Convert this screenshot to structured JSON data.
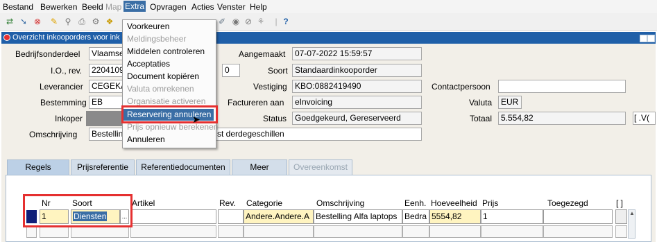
{
  "menubar": {
    "items": [
      "Bestand",
      "Bewerken",
      "Beeld",
      "Map",
      "Extra",
      "Opvragen",
      "Acties",
      "Venster",
      "Help"
    ]
  },
  "toolbar": {
    "help_glyph": "?"
  },
  "window": {
    "title": "Overzicht inkooporders voor ink"
  },
  "form": {
    "labels": {
      "bedrijfsonderdeel": "Bedrijfsonderdeel",
      "io_rev": "I.O., rev.",
      "leverancier": "Leverancier",
      "bestemming": "Bestemming",
      "inkoper": "Inkoper",
      "omschrijving": "Omschrijving",
      "aangemaakt": "Aangemaakt",
      "soort": "Soort",
      "vestiging": "Vestiging",
      "factureren_aan": "Factureren aan",
      "status": "Status",
      "contactpersoon": "Contactpersoon",
      "valuta": "Valuta",
      "totaal": "Totaal"
    },
    "values": {
      "bedrijfsonderdeel": "Vlaamse",
      "io": "2204109",
      "rev": "0",
      "leverancier": "CEGEKA",
      "bestemming": "EB",
      "omschrijving_left": "Bestellin",
      "omschrijving_right": "st derdegeschillen",
      "aangemaakt": "07-07-2022 15:59:57",
      "soort": "Standaardinkooporder",
      "vestiging": "KBO:0882419490",
      "factureren_aan": "eInvoicing",
      "status": "Goedgekeurd, Gereserveerd",
      "contactpersoon": "",
      "valuta": "EUR",
      "totaal": "5.554,82",
      "extra_field": "[ .V("
    }
  },
  "tabs": [
    "Regels",
    "Prijsreferentie",
    "Referentiedocumenten",
    "Meer",
    "Overeenkomst"
  ],
  "lines": {
    "headers": [
      "Nr",
      "Soort",
      "Artikel",
      "Rev.",
      "Categorie",
      "Omschrijving",
      "Eenh.",
      "Hoeveelheid",
      "Prijs",
      "Toegezegd",
      "[ ]"
    ],
    "row": {
      "nr": "1",
      "soort": "Diensten",
      "soort_lov": "...",
      "artikel": "",
      "rev": "",
      "categorie": "Andere.Andere.A",
      "omschrijving": "Bestelling Alfa laptops",
      "eenh": "Bedra",
      "hoeveelheid": "5554,82",
      "prijs": "1",
      "toegezegd": ""
    }
  },
  "extra_menu": {
    "items": [
      {
        "label": "Voorkeuren",
        "enabled": true
      },
      {
        "label": "Meldingsbeheer",
        "enabled": false
      },
      {
        "label": "Middelen controleren",
        "enabled": true
      },
      {
        "label": "Acceptaties",
        "enabled": true
      },
      {
        "label": "Document kopiëren",
        "enabled": true
      },
      {
        "label": "Valuta omrekenen",
        "enabled": false
      },
      {
        "label": "Organisatie activeren",
        "enabled": false
      },
      {
        "label": "Reservering annuleren",
        "enabled": true,
        "highlighted": true
      },
      {
        "label": "Prijs opnieuw berekenen",
        "enabled": false
      },
      {
        "label": "Annuleren",
        "enabled": true
      }
    ]
  },
  "colors": {
    "accent": "#3a6ea5",
    "title_bar": "#1f5fa8",
    "highlight_box": "#e53030",
    "field_yellow": "#fff4c0"
  }
}
